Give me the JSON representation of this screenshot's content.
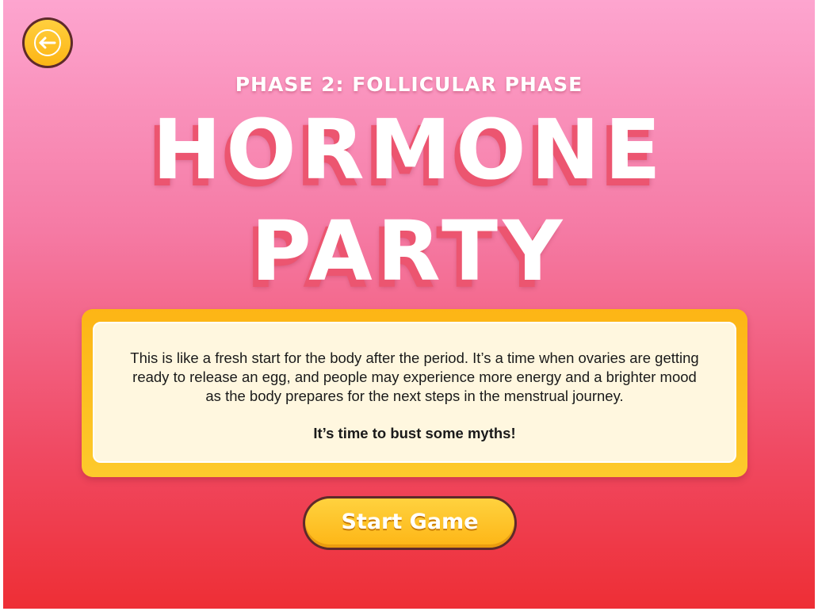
{
  "navigation": {
    "back_icon": "arrow-left-icon"
  },
  "header": {
    "subtitle": "PHASE 2: FOLLICULAR PHASE",
    "title_line_1": "HORMONE",
    "title_line_2": "PARTY"
  },
  "info_card": {
    "description": "This is like a fresh start for the body after the period. It’s a time when ovaries are getting ready to release an egg, and people may experience more energy and a brighter mood as the body prepares for the next steps in the menstrual journey.",
    "call_to_action": "It’s time to bust some myths!"
  },
  "actions": {
    "start_label": "Start Game"
  },
  "colors": {
    "background_top": "#fda5cf",
    "background_bottom": "#ee2e35",
    "accent_yellow": "#fdb515",
    "title_shadow": "#ec5570",
    "card_fill": "#fff7df",
    "button_outline": "#5e2a2a"
  }
}
